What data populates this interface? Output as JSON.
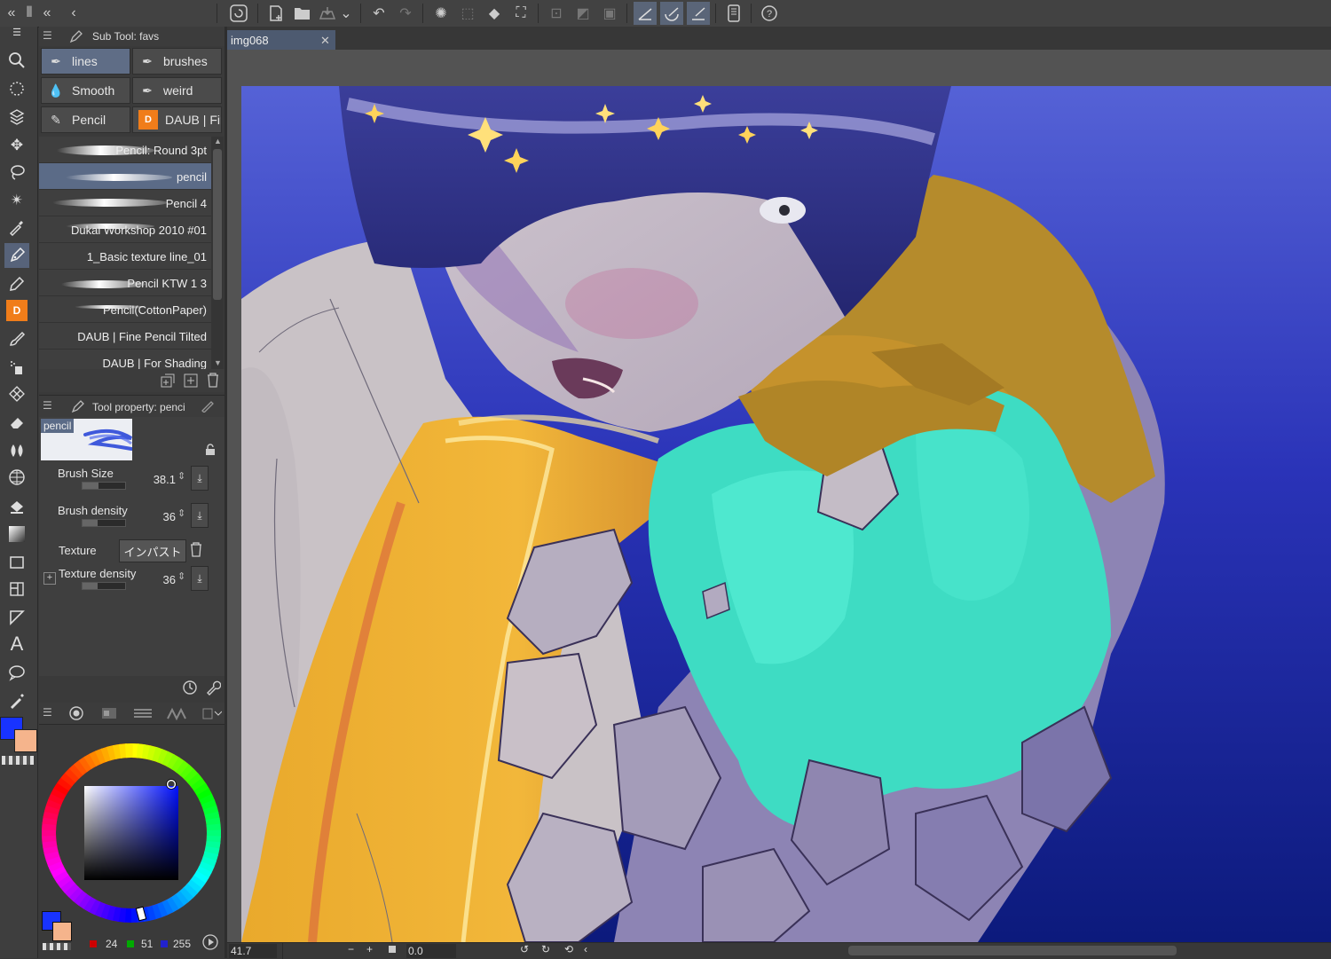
{
  "toolbar": {
    "icons": [
      "clip-studio-logo-icon",
      "new-file-icon",
      "open-folder-icon",
      "cloud-export-icon",
      "undo-icon",
      "redo-icon",
      "selection-icon",
      "lasso-select-icon",
      "fill-icon",
      "transform-icon",
      "rule-icon",
      "rule-2-icon",
      "rule-3-icon",
      "pen-pressure-icon",
      "stabilizer-icon",
      "vector-icon",
      "device-icon",
      "help-icon"
    ]
  },
  "subtool": {
    "title": "Sub Tool: favs",
    "groups": [
      {
        "label": "lines",
        "selected": true
      },
      {
        "label": "brushes",
        "selected": false
      },
      {
        "label": "Smooth",
        "selected": false
      },
      {
        "label": "weird",
        "selected": false
      },
      {
        "label": "Pencil",
        "selected": false
      },
      {
        "label": "DAUB | Fin",
        "selected": false
      }
    ],
    "brushes": [
      {
        "name": "Pencil: Round 3pt",
        "selected": false
      },
      {
        "name": "pencil",
        "selected": true
      },
      {
        "name": "Pencil 4",
        "selected": false
      },
      {
        "name": "Dukal Workshop 2010 #01",
        "selected": false
      },
      {
        "name": "1_Basic texture line_01",
        "selected": false
      },
      {
        "name": "Pencil KTW 1 3",
        "selected": false
      },
      {
        "name": "Pencil(CottonPaper)",
        "selected": false
      },
      {
        "name": "DAUB | Fine Pencil Tilted",
        "selected": false
      },
      {
        "name": "DAUB | For Shading",
        "selected": false
      }
    ]
  },
  "tool_property": {
    "title": "Tool property: penci",
    "preview_label": "pencil",
    "brush_size": {
      "label": "Brush Size",
      "value": "38.1",
      "fraction": 0.38
    },
    "brush_density": {
      "label": "Brush density",
      "value": "36",
      "fraction": 0.36
    },
    "texture": {
      "label": "Texture",
      "value": "インパスト"
    },
    "texture_density": {
      "label": "Texture density",
      "value": "36",
      "fraction": 0.36
    }
  },
  "color": {
    "main_color": "#1833ff",
    "sub_color": "#f5b48c",
    "r": "24",
    "g": "51",
    "b": "255",
    "hue_color": "#0010ff"
  },
  "document": {
    "tab_name": "img068",
    "close_glyph": "✕"
  },
  "status": {
    "zoom": "41.7",
    "angle": "0.0"
  }
}
